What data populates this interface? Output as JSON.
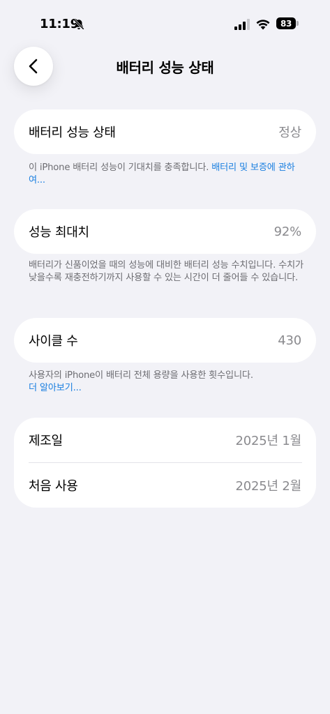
{
  "status_bar": {
    "time": "11:19",
    "battery_level": "83",
    "icons": [
      "bell-slash-icon",
      "cellular-signal-icon",
      "wifi-icon",
      "battery-icon"
    ]
  },
  "nav": {
    "back_icon": "chevron-left-icon",
    "title": "배터리 성능 상태"
  },
  "health_card": {
    "label": "배터리 성능 상태",
    "value": "정상"
  },
  "health_note": {
    "text": "이 iPhone 배터리 성능이 기대치를 충족합니다. ",
    "link": "배터리 및 보증에 관하여..."
  },
  "capacity_card": {
    "label": "성능 최대치",
    "value": "92%"
  },
  "capacity_note": {
    "text": "배터리가 신품이었을 때의 성능에 대비한 배터리 성능 수치입니다. 수치가 낮을수록 재충전하기까지 사용할 수 있는 시간이 더 줄어들 수 있습니다."
  },
  "cycle_card": {
    "label": "사이클 수",
    "value": "430"
  },
  "cycle_note": {
    "text": "사용자의 iPhone이 배터리 전체 용량을 사용한 횟수입니다.",
    "link": "더 알아보기..."
  },
  "dates_card": {
    "rows": [
      {
        "label": "제조일",
        "value": "2025년 1월"
      },
      {
        "label": "처음 사용",
        "value": "2025년 2월"
      }
    ]
  },
  "colors": {
    "background": "#f2f2f7",
    "card": "#ffffff",
    "secondary_text": "#8a8a8e",
    "footnote_text": "#6d6d72",
    "link": "#1a7fe0"
  }
}
